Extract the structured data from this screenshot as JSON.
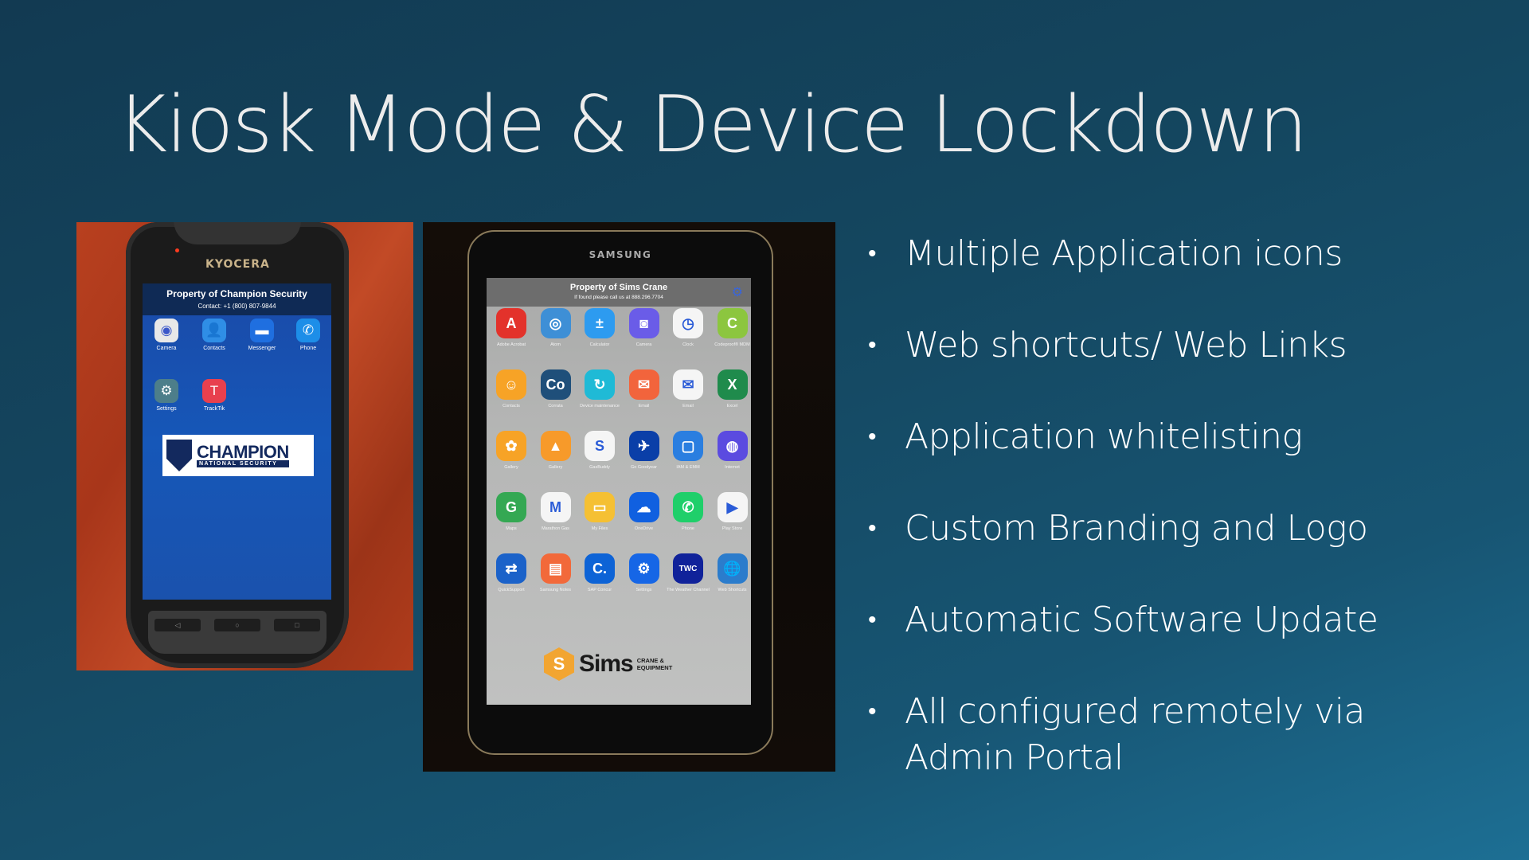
{
  "slide": {
    "title": "Kiosk Mode & Device Lockdown",
    "bullets": [
      "Multiple Application icons",
      "Web shortcuts/ Web Links",
      "Application whitelisting",
      "Custom Branding and Logo",
      "Automatic Software Update",
      "All configured remotely via Admin Portal"
    ],
    "bullet_glyph": "•"
  },
  "photo_kyocera": {
    "device_brand": "KYOCERA",
    "header_title": "Property of Champion Security",
    "header_contact": "Contact: +1 (800) 807-9844",
    "apps": [
      {
        "label": "Camera",
        "icon": "camera-icon",
        "glyph": "◉",
        "color": "#e8e8e8"
      },
      {
        "label": "Contacts",
        "icon": "contacts-icon",
        "glyph": "👤",
        "color": "#2f8ee6"
      },
      {
        "label": "Messenger",
        "icon": "messenger-icon",
        "glyph": "▬",
        "color": "#1f6fe0"
      },
      {
        "label": "Phone",
        "icon": "phone-icon",
        "glyph": "✆",
        "color": "#1d8ee8"
      },
      {
        "label": "Settings",
        "icon": "settings-icon",
        "glyph": "⚙",
        "color": "#4d7e8a"
      },
      {
        "label": "TrackTik",
        "icon": "tracktik-icon",
        "glyph": "T",
        "color": "#e8404e"
      }
    ],
    "logo_name": "CHAMPION",
    "logo_sub": "NATIONAL SECURITY",
    "nav_buttons": [
      "◁",
      "○",
      "□"
    ]
  },
  "photo_samsung": {
    "device_brand": "SAMSUNG",
    "header_title": "Property of Sims Crane",
    "header_subtitle": "If found please call us at 888.296.7704",
    "apps": [
      {
        "label": "Adobe Acrobat",
        "icon": "adobe-acrobat-icon",
        "glyph": "A",
        "color": "#e3322b"
      },
      {
        "label": "Atom",
        "icon": "atom-icon",
        "glyph": "◎",
        "color": "#3e8fd6"
      },
      {
        "label": "Calculator",
        "icon": "calculator-icon",
        "glyph": "±",
        "color": "#2d9bf0"
      },
      {
        "label": "Camera",
        "icon": "camera-icon",
        "glyph": "◙",
        "color": "#6a5ce8"
      },
      {
        "label": "Clock",
        "icon": "clock-icon",
        "glyph": "◷",
        "color": "#f5f5f5"
      },
      {
        "label": "Codeproof® MDM",
        "icon": "codeproof-icon",
        "glyph": "C",
        "color": "#8cc63f"
      },
      {
        "label": "Contacts",
        "icon": "contacts-icon",
        "glyph": "☺",
        "color": "#f7a326"
      },
      {
        "label": "Corrata",
        "icon": "corrata-icon",
        "glyph": "Co",
        "color": "#1f4f7a"
      },
      {
        "label": "Device maintenance",
        "icon": "device-maintenance-icon",
        "glyph": "↻",
        "color": "#1fbad6"
      },
      {
        "label": "Email",
        "icon": "email-icon",
        "glyph": "✉",
        "color": "#f2643c"
      },
      {
        "label": "Email",
        "icon": "email-icon",
        "glyph": "✉",
        "color": "#f5f5f5"
      },
      {
        "label": "Excel",
        "icon": "excel-icon",
        "glyph": "X",
        "color": "#1f8b4c"
      },
      {
        "label": "Gallery",
        "icon": "gallery-icon",
        "glyph": "✿",
        "color": "#f7a326"
      },
      {
        "label": "Gallery",
        "icon": "gallery-icon",
        "glyph": "▲",
        "color": "#f79a2a"
      },
      {
        "label": "GasBuddy",
        "icon": "gasbuddy-icon",
        "glyph": "S",
        "color": "#f5f5f5"
      },
      {
        "label": "Go Goodyear",
        "icon": "goodyear-icon",
        "glyph": "✈",
        "color": "#0a3fa8"
      },
      {
        "label": "IAM & EMM",
        "icon": "iam-emm-icon",
        "glyph": "▢",
        "color": "#2a7ee0"
      },
      {
        "label": "Internet",
        "icon": "internet-icon",
        "glyph": "◍",
        "color": "#5b4be0"
      },
      {
        "label": "Maps",
        "icon": "maps-icon",
        "glyph": "G",
        "color": "#34a853"
      },
      {
        "label": "Marathon Gas",
        "icon": "marathon-icon",
        "glyph": "M",
        "color": "#f5f5f5"
      },
      {
        "label": "My Files",
        "icon": "my-files-icon",
        "glyph": "▭",
        "color": "#f5c033"
      },
      {
        "label": "OneDrive",
        "icon": "onedrive-icon",
        "glyph": "☁",
        "color": "#1060e0"
      },
      {
        "label": "Phone",
        "icon": "phone-icon",
        "glyph": "✆",
        "color": "#1fcf6a"
      },
      {
        "label": "Play Store",
        "icon": "play-store-icon",
        "glyph": "▶",
        "color": "#f5f5f5"
      },
      {
        "label": "QuickSupport",
        "icon": "quicksupport-icon",
        "glyph": "⇄",
        "color": "#1b62c9"
      },
      {
        "label": "Samsung Notes",
        "icon": "samsung-notes-icon",
        "glyph": "▤",
        "color": "#f2693a"
      },
      {
        "label": "SAP Concur",
        "icon": "sap-concur-icon",
        "glyph": "C.",
        "color": "#0d63d6"
      },
      {
        "label": "Settings",
        "icon": "settings-icon",
        "glyph": "⚙",
        "color": "#1666e6"
      },
      {
        "label": "The Weather Channel",
        "icon": "weather-channel-icon",
        "glyph": "TWC",
        "color": "#10229a"
      },
      {
        "label": "Web Shortcuts",
        "icon": "web-shortcuts-icon",
        "glyph": "🌐",
        "color": "#2b7ccc"
      }
    ],
    "logo_name": "Sims",
    "logo_sub_1": "CRANE &",
    "logo_sub_2": "EQUIPMENT",
    "logo_glyph": "S"
  }
}
